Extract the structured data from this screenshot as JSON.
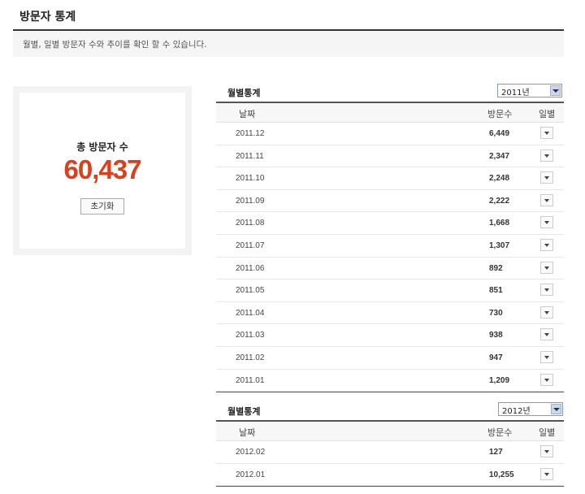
{
  "header": {
    "title": "방문자 통계",
    "description": "월별, 일별 방문자 수와 추이를 확인 할 수 있습니다."
  },
  "total": {
    "label": "총 방문자 수",
    "value": "60,437",
    "reset_label": "초기화",
    "value_color": "#d9411e"
  },
  "tables": [
    {
      "title": "월별통계",
      "year_selected": "2011년",
      "columns": {
        "date": "날짜",
        "visits": "방문수",
        "daily": "일별"
      },
      "rows": [
        {
          "date": "2011.12",
          "visits": "6,449"
        },
        {
          "date": "2011.11",
          "visits": "2,347"
        },
        {
          "date": "2011.10",
          "visits": "2,248"
        },
        {
          "date": "2011.09",
          "visits": "2,222"
        },
        {
          "date": "2011.08",
          "visits": "1,668"
        },
        {
          "date": "2011.07",
          "visits": "1,307"
        },
        {
          "date": "2011.06",
          "visits": "892"
        },
        {
          "date": "2011.05",
          "visits": "851"
        },
        {
          "date": "2011.04",
          "visits": "730"
        },
        {
          "date": "2011.03",
          "visits": "938"
        },
        {
          "date": "2011.02",
          "visits": "947"
        },
        {
          "date": "2011.01",
          "visits": "1,209"
        }
      ]
    },
    {
      "title": "월별통계",
      "year_selected": "2012년",
      "columns": {
        "date": "날짜",
        "visits": "방문수",
        "daily": "일별"
      },
      "rows": [
        {
          "date": "2012.02",
          "visits": "127"
        },
        {
          "date": "2012.01",
          "visits": "10,255"
        }
      ]
    }
  ]
}
